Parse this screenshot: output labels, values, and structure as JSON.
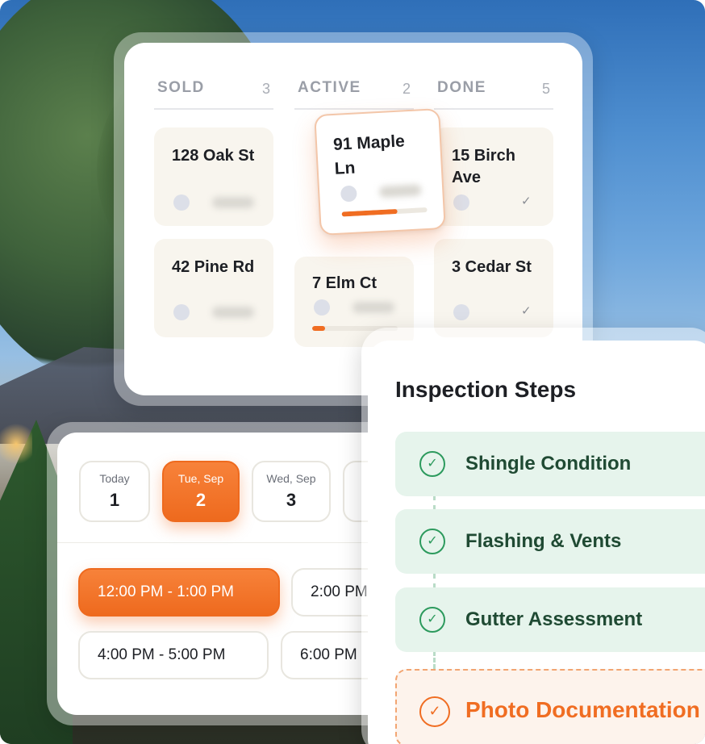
{
  "kanban": {
    "columns": [
      {
        "title": "SOLD",
        "count": "3"
      },
      {
        "title": "ACTIVE",
        "count": "2"
      },
      {
        "title": "DONE",
        "count": "5"
      }
    ],
    "cards": {
      "sold": [
        "128 Oak St",
        "42 Pine Rd"
      ],
      "active": [
        "91 Maple Ln",
        "7 Elm Ct"
      ],
      "done": [
        "15 Birch Ave",
        "3 Cedar St"
      ]
    },
    "progress": {
      "maple": 0.65,
      "elm": 0.15
    },
    "check_icon": "check-icon",
    "accent_color": "#f06d22"
  },
  "schedule": {
    "dates": [
      {
        "label": "Today",
        "day": "1"
      },
      {
        "label": "Tue, Sep",
        "day": "2"
      },
      {
        "label": "Wed, Sep",
        "day": "3"
      }
    ],
    "selected_date_index": 1,
    "slots": [
      "12:00 PM - 1:00 PM",
      "2:00 PM",
      "4:00 PM - 5:00 PM",
      "6:00 PM"
    ],
    "selected_slot_index": 0
  },
  "inspection": {
    "title": "Inspection Steps",
    "steps": [
      {
        "label": "Shingle Condition",
        "status": "done"
      },
      {
        "label": "Flashing & Vents",
        "status": "done"
      },
      {
        "label": "Gutter Assessment",
        "status": "done"
      },
      {
        "label": "Photo Documentation",
        "status": "pending"
      }
    ],
    "done_color": "#2c9a5d",
    "pending_color": "#f06d22"
  }
}
